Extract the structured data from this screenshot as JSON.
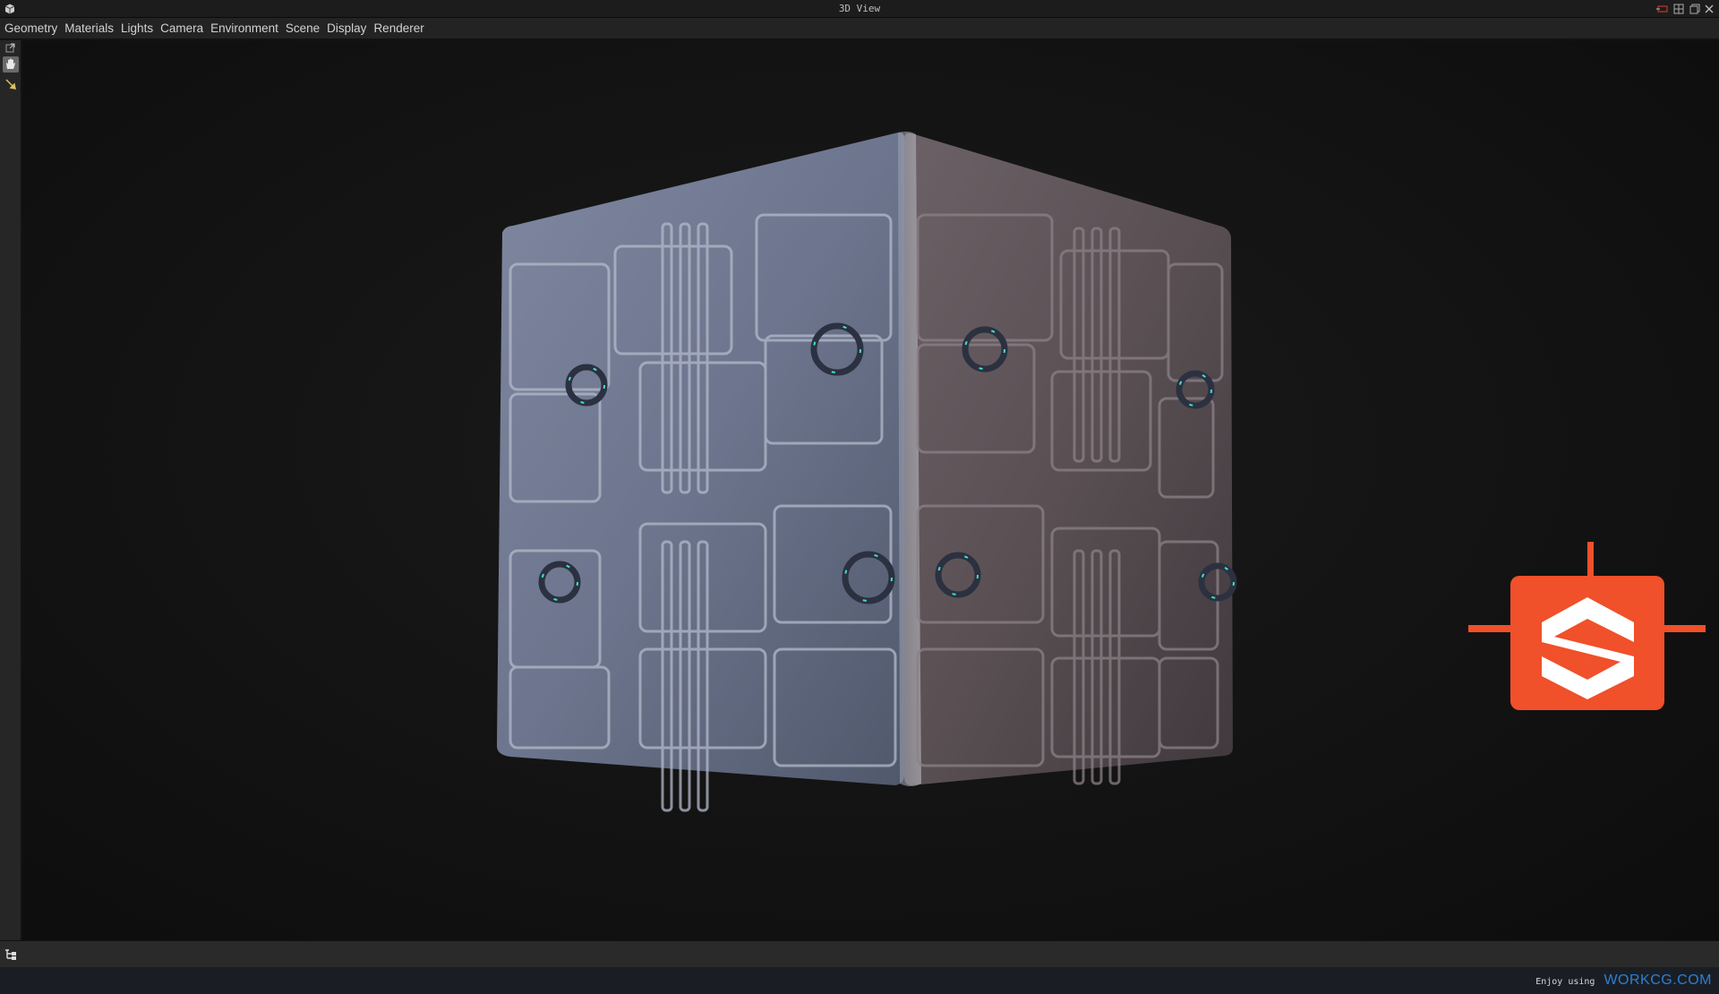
{
  "window": {
    "title": "3D View",
    "controls": [
      "pin-icon",
      "tile-icon",
      "restore-icon",
      "close-icon"
    ]
  },
  "menu": {
    "items": [
      "Geometry",
      "Materials",
      "Lights",
      "Camera",
      "Environment",
      "Scene",
      "Display",
      "Renderer"
    ]
  },
  "toolbar": {
    "tools": [
      "popout-icon",
      "hand-icon",
      "pick-icon"
    ],
    "active_tool": "hand-icon"
  },
  "viewport": {
    "model": "cube",
    "material": "sci-fi panel",
    "emissive_color": "#3fe0d0"
  },
  "logo": {
    "name": "substance-logo",
    "color": "#f0502a"
  },
  "bottom_bar": {
    "icons": [
      "scene-tree-icon"
    ]
  },
  "status": {
    "watermark_prefix": "Enjoy using",
    "watermark_site": "WORKCG.COM",
    "site_color": "#2d7fd3"
  }
}
